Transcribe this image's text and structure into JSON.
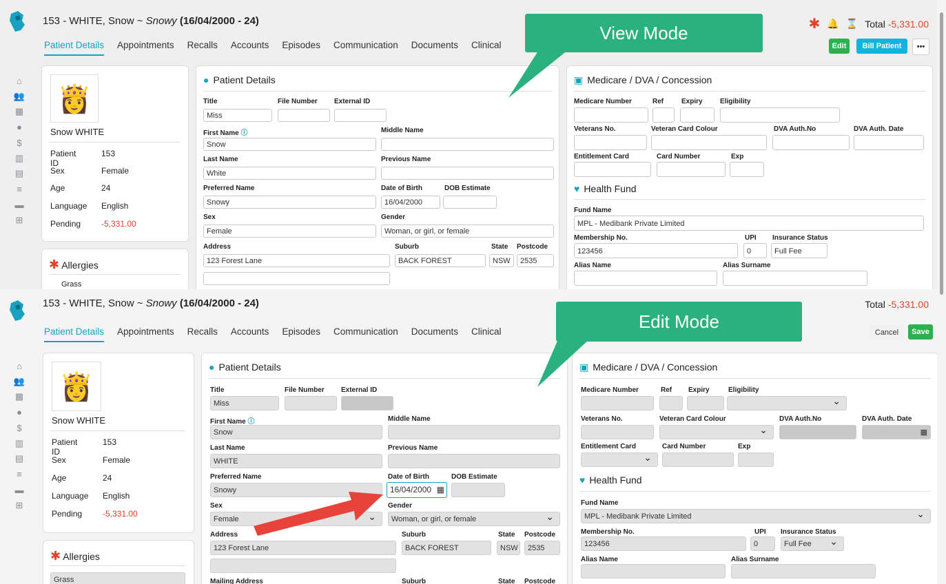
{
  "header": {
    "title_prefix": "153 - WHITE, Snow ~ ",
    "preferred": "Snowy",
    "title_suffix": " (16/04/2000 - 24)",
    "total_label": "Total",
    "total_value": "-5,331.00"
  },
  "tabs": [
    "Patient Details",
    "Appointments",
    "Recalls",
    "Accounts",
    "Episodes",
    "Communication",
    "Documents",
    "Clinical"
  ],
  "buttons": {
    "edit": "Edit",
    "bill": "Bill Patient",
    "more": "•••",
    "cancel": "Cancel",
    "save": "Save"
  },
  "callouts": {
    "view": "View Mode",
    "edit": "Edit Mode"
  },
  "summary": {
    "name": "Snow WHITE",
    "rows": [
      [
        "Patient ID",
        "153"
      ],
      [
        "Sex",
        "Female"
      ],
      [
        "Age",
        "24"
      ],
      [
        "Language",
        "English"
      ],
      [
        "Pending",
        "-5,331.00"
      ]
    ],
    "allergies_title": "Allergies",
    "allergy": "Grass"
  },
  "pd": {
    "title": "Patient Details",
    "l_title": "Title",
    "l_file": "File Number",
    "l_ext": "External ID",
    "title_v": "Miss",
    "l_first": "First Name",
    "l_middle": "Middle Name",
    "first_v": "Snow",
    "l_last": "Last Name",
    "l_prev": "Previous Name",
    "last_v": "White",
    "last_v_edit": "WHITE",
    "l_pref": "Preferred Name",
    "l_dob": "Date of Birth",
    "l_dobest": "DOB Estimate",
    "pref_v": "Snowy",
    "dob_v": "16/04/2000",
    "l_sex": "Sex",
    "l_gender": "Gender",
    "sex_v": "Female",
    "gender_v": "Woman, or girl, or female",
    "l_addr": "Address",
    "l_suburb": "Suburb",
    "l_state": "State",
    "l_post": "Postcode",
    "addr_v": "123 Forest Lane",
    "suburb_v": "BACK FOREST",
    "state_v": "NSW",
    "post_v": "2535",
    "l_mail": "Mailing Address"
  },
  "med": {
    "title": "Medicare / DVA / Concession",
    "l_num": "Medicare Number",
    "l_ref": "Ref",
    "l_exp": "Expiry",
    "l_elig": "Eligibility",
    "l_vet": "Veterans No.",
    "l_vcc": "Veteran Card Colour",
    "l_dva": "DVA Auth.No",
    "l_dvad": "DVA Auth. Date",
    "l_ent": "Entitlement Card",
    "l_card": "Card Number",
    "l_cexp": "Exp"
  },
  "hf": {
    "title": "Health Fund",
    "l_fund": "Fund Name",
    "fund_v": "MPL - Medibank Private Limited",
    "l_mem": "Membership No.",
    "l_upi": "UPI",
    "l_ins": "Insurance Status",
    "mem_v": "123456",
    "upi_v": "0",
    "ins_v": "Full Fee",
    "l_alias": "Alias Name",
    "l_aliass": "Alias Surname"
  },
  "colors": {
    "accent": "#17a2c1",
    "green": "#2db14e",
    "red": "#e0422b",
    "callout": "#2bb07f"
  }
}
